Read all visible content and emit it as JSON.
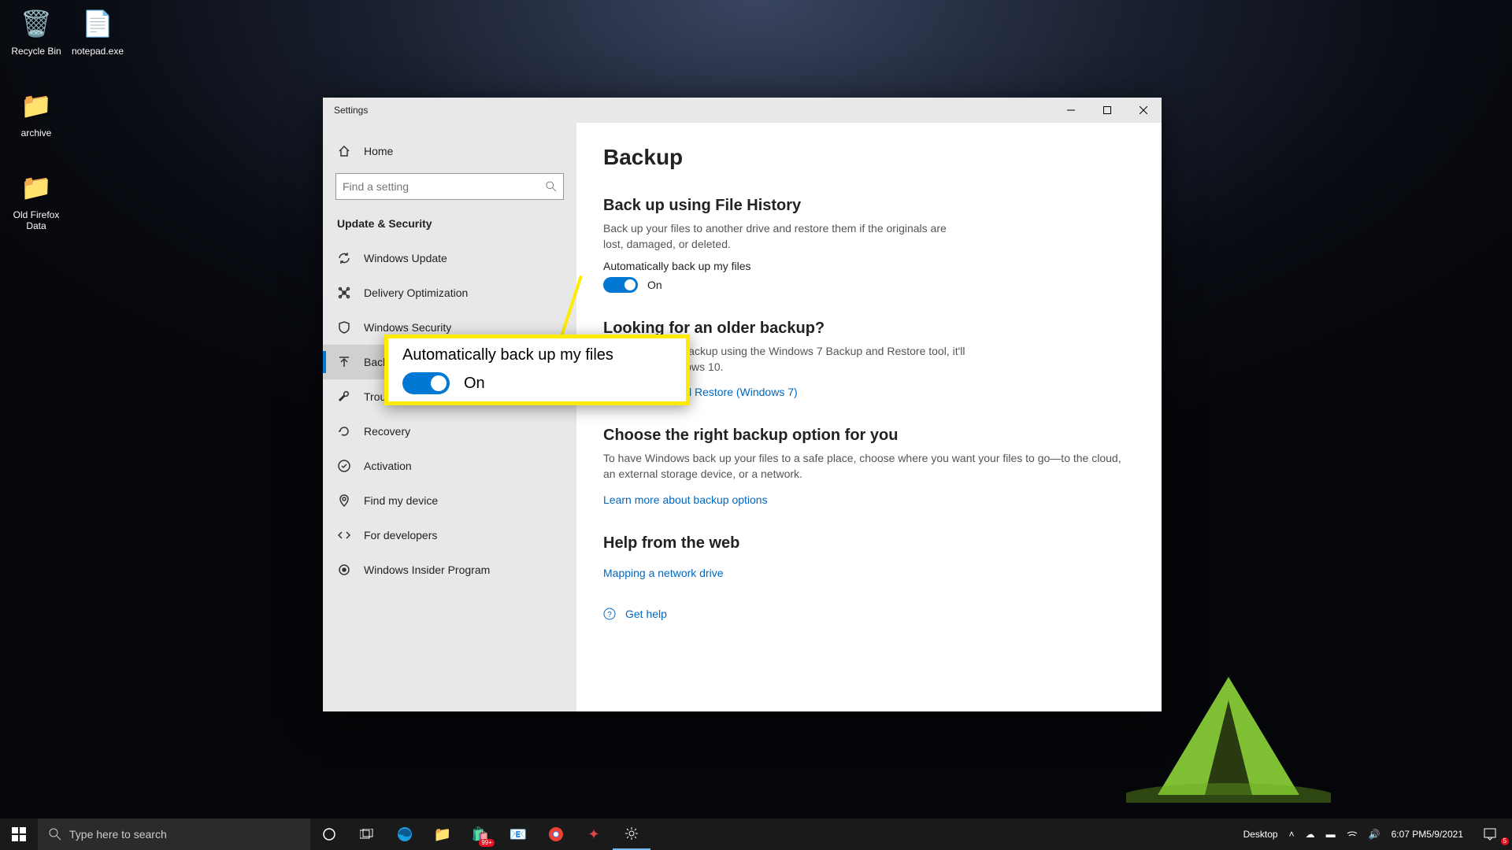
{
  "desktop": {
    "icons": [
      {
        "label": "Recycle Bin"
      },
      {
        "label": "notepad.exe"
      },
      {
        "label": "archive"
      },
      {
        "label": "Old Firefox Data"
      }
    ]
  },
  "window": {
    "title": "Settings",
    "sidebar": {
      "home": "Home",
      "search_placeholder": "Find a setting",
      "category": "Update & Security",
      "items": [
        {
          "label": "Windows Update"
        },
        {
          "label": "Delivery Optimization"
        },
        {
          "label": "Windows Security"
        },
        {
          "label": "Backup"
        },
        {
          "label": "Troubleshoot"
        },
        {
          "label": "Recovery"
        },
        {
          "label": "Activation"
        },
        {
          "label": "Find my device"
        },
        {
          "label": "For developers"
        },
        {
          "label": "Windows Insider Program"
        }
      ],
      "selected_index": 3
    },
    "main": {
      "heading": "Backup",
      "file_history": {
        "title": "Back up using File History",
        "desc": "Back up your files to another drive and restore them if the originals are lost, damaged, or deleted.",
        "toggle_label": "Automatically back up my files",
        "toggle_state": "On"
      },
      "older": {
        "title": "Looking for an older backup?",
        "desc": "If you created a backup using the Windows 7 Backup and Restore tool, it'll still work in Windows 10.",
        "link": "Go to Backup and Restore (Windows 7)"
      },
      "choose": {
        "title": "Choose the right backup option for you",
        "desc": "To have Windows back up your files to a safe place, choose where you want your files to go—to the cloud, an external storage device, or a network.",
        "link": "Learn more about backup options"
      },
      "help": {
        "title": "Help from the web",
        "link": "Mapping a network drive"
      },
      "get_help": "Get help"
    }
  },
  "callout": {
    "label": "Automatically back up my files",
    "state": "On"
  },
  "taskbar": {
    "search_placeholder": "Type here to search",
    "store_badge": "99+",
    "tray_label": "Desktop",
    "clock_time": "6:07 PM",
    "clock_date": "5/9/2021",
    "notif_count": "5"
  }
}
